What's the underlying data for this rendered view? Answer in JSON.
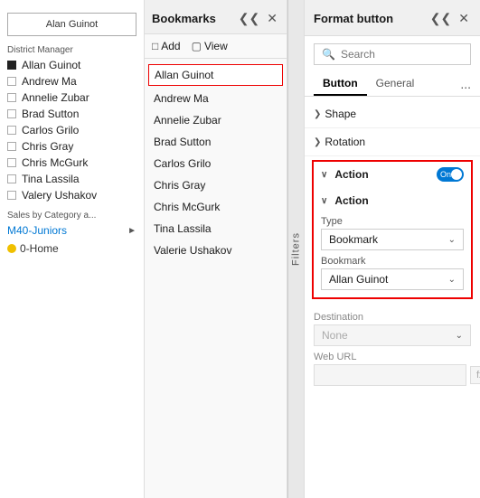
{
  "leftPanel": {
    "filterBox": "Alan Guinot",
    "districtLabel": "District Manager",
    "districtItems": [
      {
        "type": "dot",
        "label": "Allan Guinot"
      },
      {
        "type": "checkbox",
        "label": "Andrew Ma"
      },
      {
        "type": "checkbox",
        "label": "Annelie Zubar"
      },
      {
        "type": "checkbox",
        "label": "Brad Sutton"
      },
      {
        "type": "checkbox",
        "label": "Carlos Grilo"
      },
      {
        "type": "checkbox",
        "label": "Chris Gray"
      },
      {
        "type": "checkbox",
        "label": "Chris McGurk"
      },
      {
        "type": "checkbox",
        "label": "Tina Lassila"
      },
      {
        "type": "checkbox",
        "label": "Valery Ushakov"
      }
    ],
    "salesLabel": "Sales by Category a...",
    "m40Label": "M40-Juniors",
    "homeLabel": "0-Home"
  },
  "bookmarks": {
    "title": "Bookmarks",
    "addLabel": "Add",
    "viewLabel": "View",
    "items": [
      {
        "label": "Allan Guinot",
        "active": true
      },
      {
        "label": "Andrew Ma",
        "active": false
      },
      {
        "label": "Annelie Zubar",
        "active": false
      },
      {
        "label": "Brad Sutton",
        "active": false
      },
      {
        "label": "Carlos Grilo",
        "active": false
      },
      {
        "label": "Chris Gray",
        "active": false
      },
      {
        "label": "Chris McGurk",
        "active": false
      },
      {
        "label": "Tina Lassila",
        "active": false
      },
      {
        "label": "Valerie Ushakov",
        "active": false
      }
    ],
    "filtersLabel": "Filters"
  },
  "formatPanel": {
    "title": "Format button",
    "search": {
      "placeholder": "Search"
    },
    "tabs": [
      {
        "label": "Button",
        "active": true
      },
      {
        "label": "General",
        "active": false
      }
    ],
    "tabMore": "...",
    "sections": [
      {
        "label": "Shape"
      },
      {
        "label": "Rotation"
      }
    ],
    "action": {
      "label": "Action",
      "toggleLabel": "On",
      "subLabel": "Action",
      "typeLabel": "Type",
      "typeValue": "Bookmark",
      "bookmarkLabel": "Bookmark",
      "bookmarkValue": "Allan Guinot",
      "destinationLabel": "Destination",
      "destinationValue": "None",
      "webUrlLabel": "Web URL",
      "webUrlValue": "",
      "fxLabel": "fx"
    }
  }
}
